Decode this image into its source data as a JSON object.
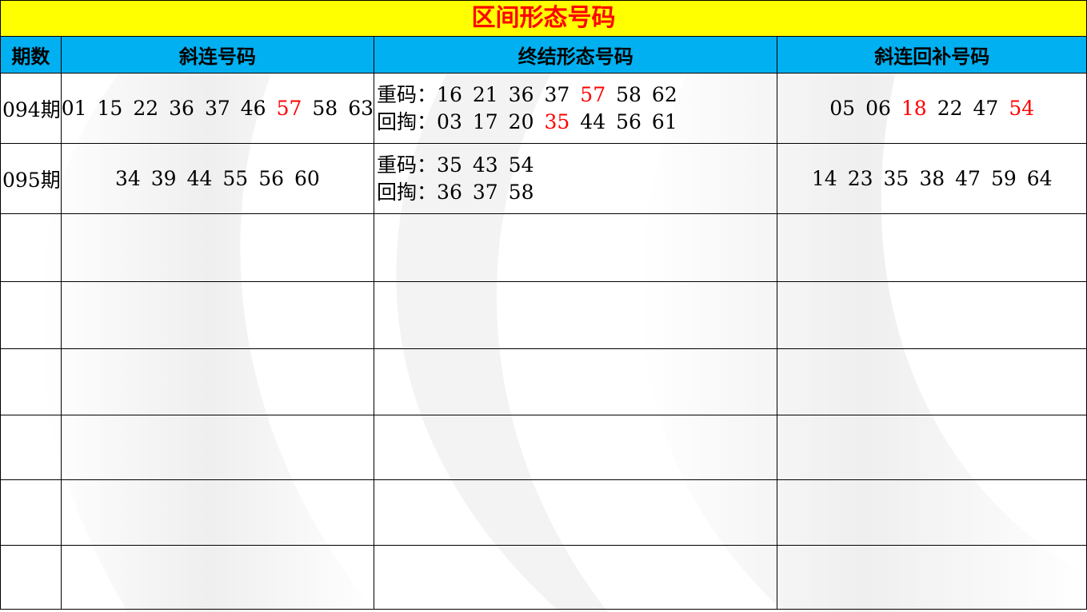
{
  "title": "区间形态号码",
  "headers": {
    "period": "期数",
    "diag": "斜连号码",
    "end": "终结形态号码",
    "supp": "斜连回补号码"
  },
  "colors": {
    "title_bg": "#ffff00",
    "title_text": "#ff0000",
    "header_bg": "#00b0f0",
    "highlight": "#ff0000"
  },
  "rows": [
    {
      "period": "094期",
      "diag": [
        {
          "v": "01",
          "red": false
        },
        {
          "v": "15",
          "red": false
        },
        {
          "v": "22",
          "red": false
        },
        {
          "v": "36",
          "red": false
        },
        {
          "v": "37",
          "red": false
        },
        {
          "v": "46",
          "red": false
        },
        {
          "v": "57",
          "red": true
        },
        {
          "v": "58",
          "red": false
        },
        {
          "v": "63",
          "red": false
        }
      ],
      "end_line1_label": "重码：",
      "end_line1": [
        {
          "v": "16",
          "red": false
        },
        {
          "v": "21",
          "red": false
        },
        {
          "v": "36",
          "red": false
        },
        {
          "v": "37",
          "red": false
        },
        {
          "v": "57",
          "red": true
        },
        {
          "v": "58",
          "red": false
        },
        {
          "v": "62",
          "red": false
        }
      ],
      "end_line2_label": "回掏：",
      "end_line2": [
        {
          "v": "03",
          "red": false
        },
        {
          "v": "17",
          "red": false
        },
        {
          "v": "20",
          "red": false
        },
        {
          "v": "35",
          "red": true
        },
        {
          "v": "44",
          "red": false
        },
        {
          "v": "56",
          "red": false
        },
        {
          "v": "61",
          "red": false
        }
      ],
      "supp": [
        {
          "v": "05",
          "red": false
        },
        {
          "v": "06",
          "red": false
        },
        {
          "v": "18",
          "red": true
        },
        {
          "v": "22",
          "red": false
        },
        {
          "v": "47",
          "red": false
        },
        {
          "v": "54",
          "red": true
        }
      ]
    },
    {
      "period": "095期",
      "diag": [
        {
          "v": "34",
          "red": false
        },
        {
          "v": "39",
          "red": false
        },
        {
          "v": "44",
          "red": false
        },
        {
          "v": "55",
          "red": false
        },
        {
          "v": "56",
          "red": false
        },
        {
          "v": "60",
          "red": false
        }
      ],
      "end_line1_label": "重码：",
      "end_line1": [
        {
          "v": "35",
          "red": false
        },
        {
          "v": "43",
          "red": false
        },
        {
          "v": "54",
          "red": false
        }
      ],
      "end_line2_label": "回掏：",
      "end_line2": [
        {
          "v": "36",
          "red": false
        },
        {
          "v": "37",
          "red": false
        },
        {
          "v": "58",
          "red": false
        }
      ],
      "supp": [
        {
          "v": "14",
          "red": false
        },
        {
          "v": "23",
          "red": false
        },
        {
          "v": "35",
          "red": false
        },
        {
          "v": "38",
          "red": false
        },
        {
          "v": "47",
          "red": false
        },
        {
          "v": "59",
          "red": false
        },
        {
          "v": "64",
          "red": false
        }
      ]
    }
  ],
  "empty_rows": 6
}
